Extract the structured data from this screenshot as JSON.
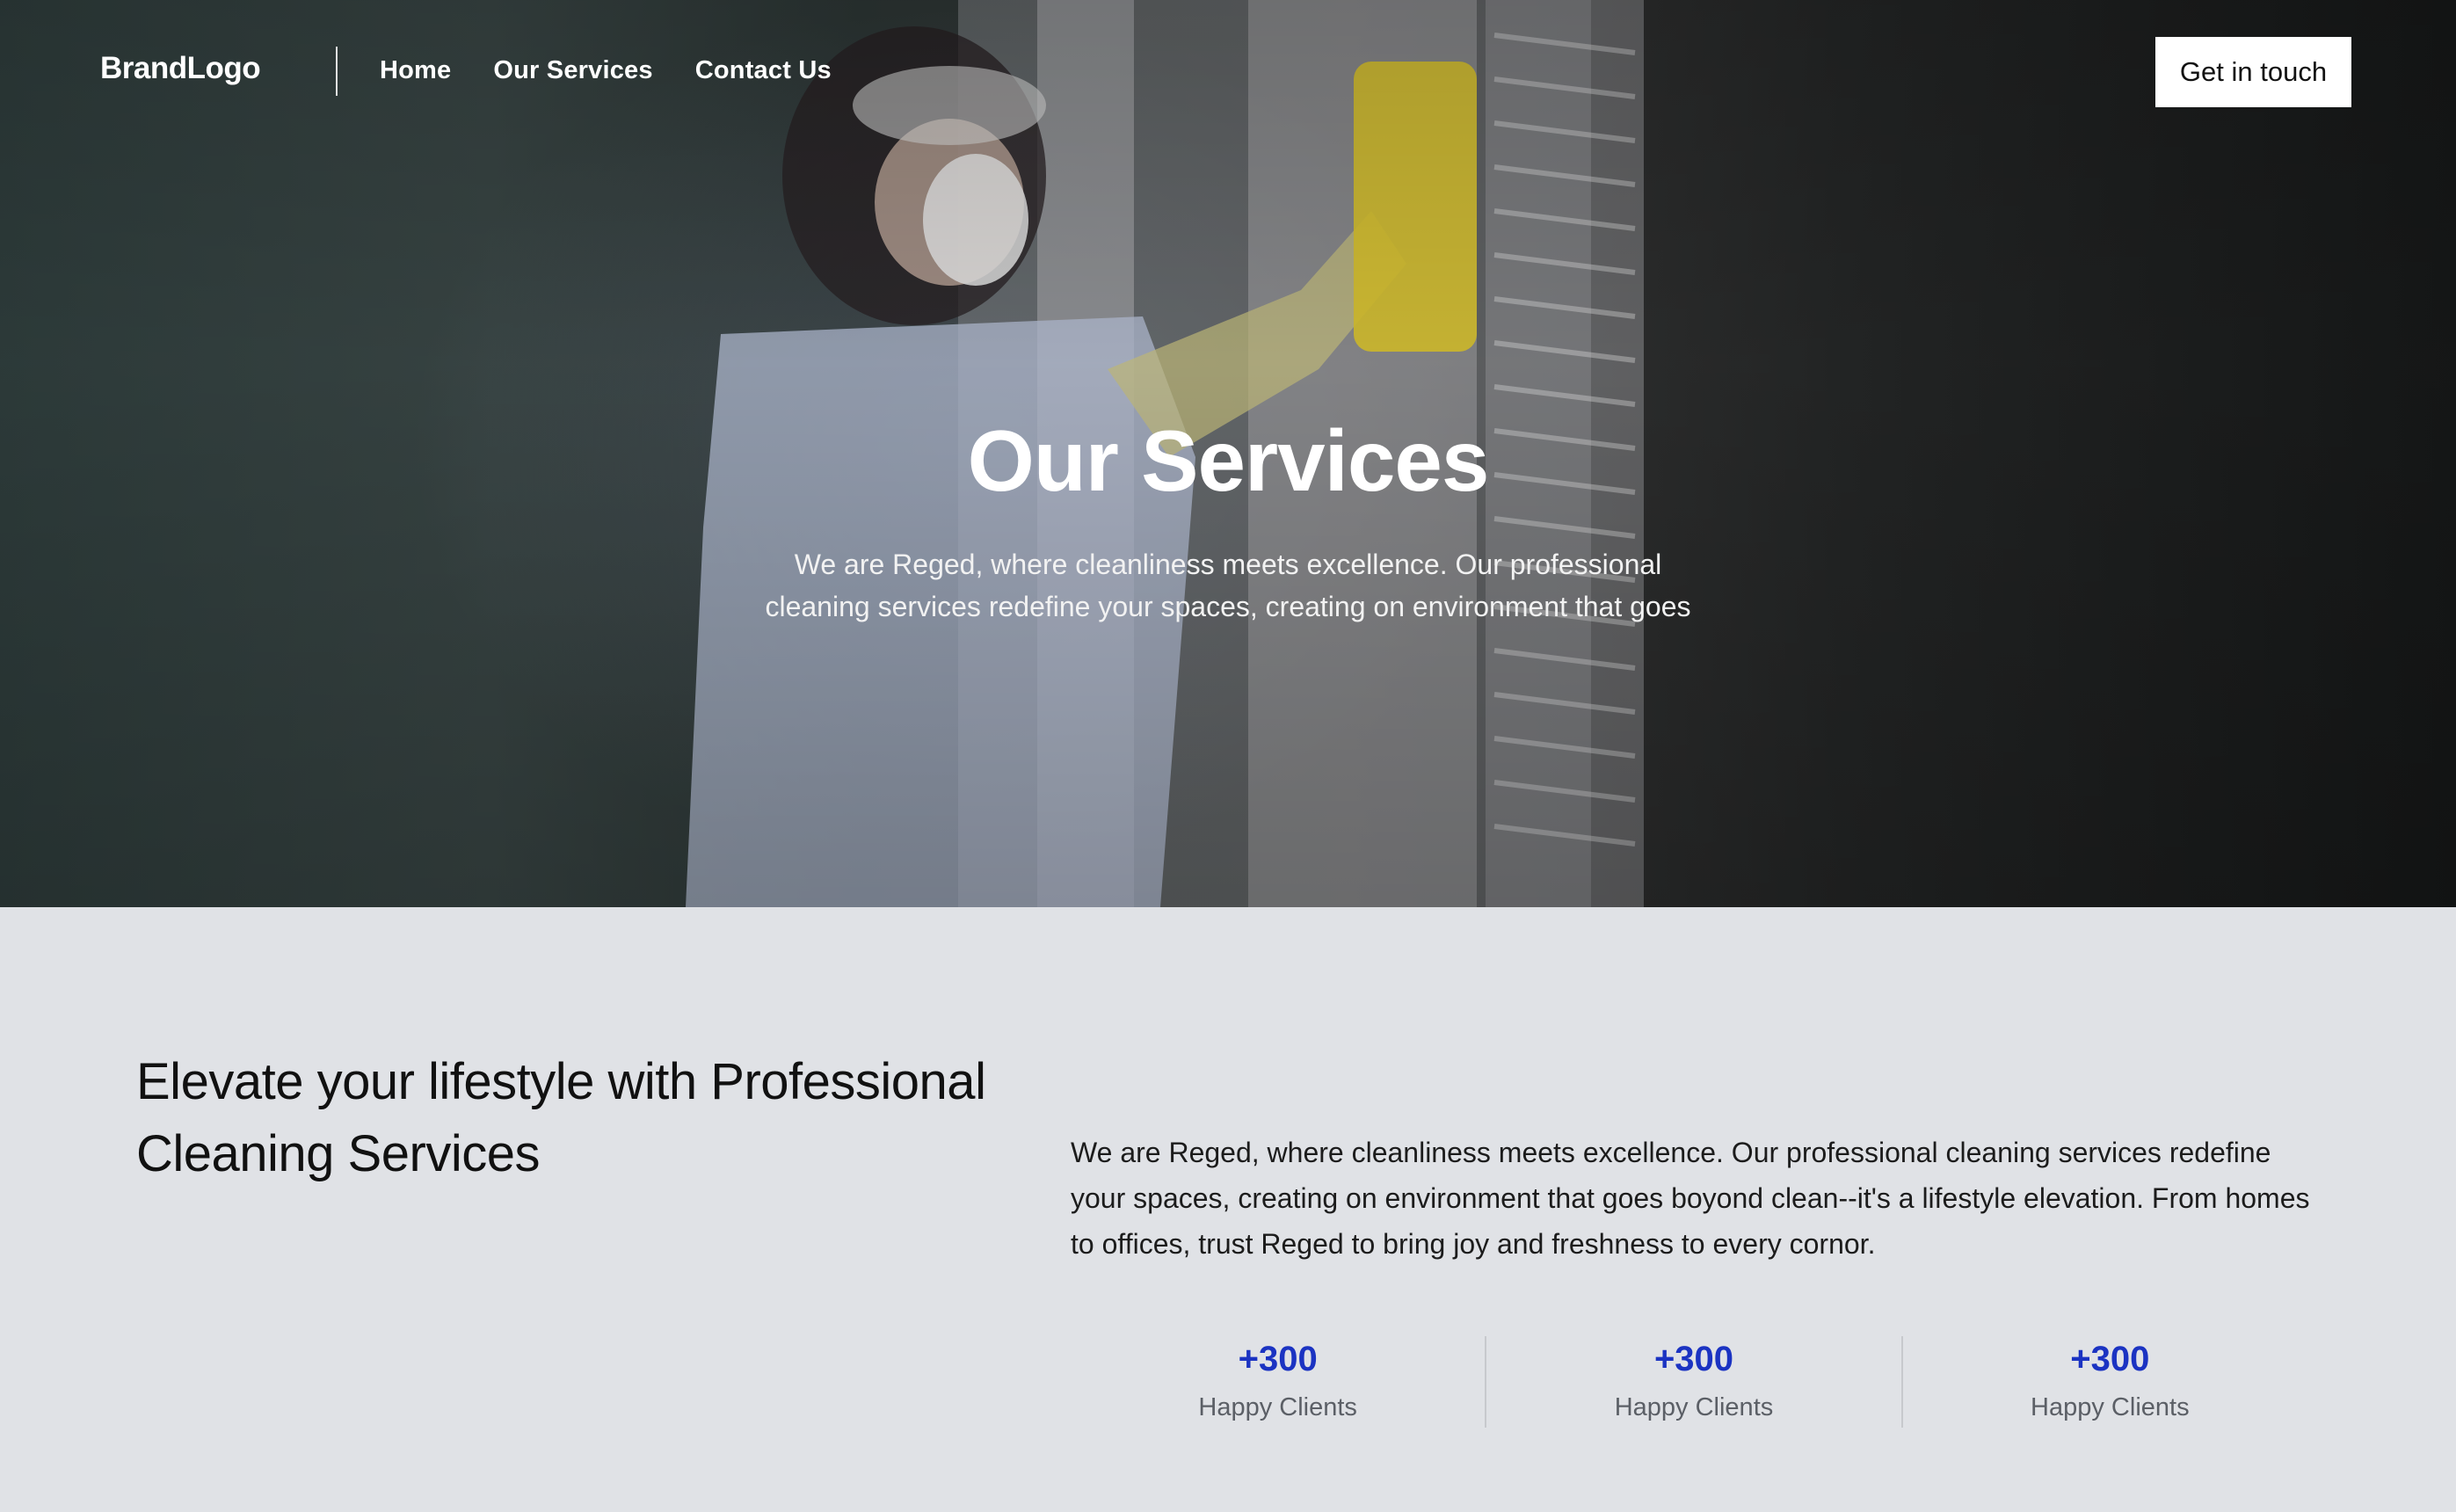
{
  "nav": {
    "brand": "BrandLogo",
    "links": [
      {
        "label": "Home"
      },
      {
        "label": "Our Services"
      },
      {
        "label": "Contact Us"
      }
    ],
    "cta_label": "Get in touch"
  },
  "hero": {
    "title": "Our Services",
    "subtitle": "We are Reged, where cleanliness meets excellence. Our professional cleaning services redefine your spaces, creating on environment that goes"
  },
  "intro": {
    "heading": "Elevate your lifestyle with Professional Cleaning Services",
    "body": "We are Reged, where cleanliness meets excellence. Our professional cleaning services redefine your spaces, creating on environment that goes boyond clean--it's a lifestyle elevation. From homes to offices, trust Reged to bring joy and freshness to every cornor."
  },
  "stats": [
    {
      "value": "+300",
      "label": "Happy Clients"
    },
    {
      "value": "+300",
      "label": "Happy Clients"
    },
    {
      "value": "+300",
      "label": "Happy Clients"
    }
  ],
  "colors": {
    "accent": "#1b33c2",
    "section_bg": "#e0e2e6",
    "text_dark": "#111111",
    "text_muted": "#5b5f66"
  }
}
